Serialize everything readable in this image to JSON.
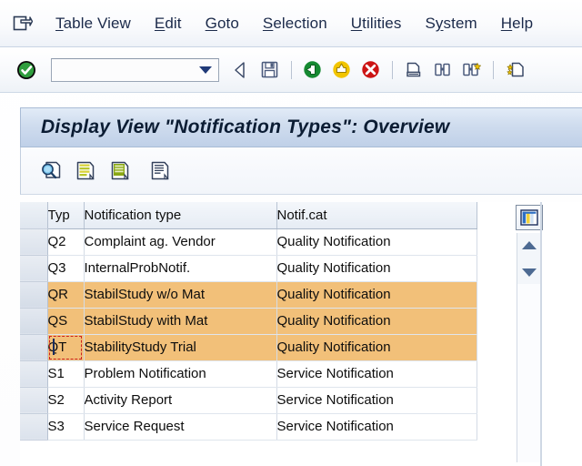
{
  "window": {
    "icon": "sap-exit-arrow-icon"
  },
  "menubar": {
    "items": [
      {
        "label": "Table View",
        "accel_index": 0
      },
      {
        "label": "Edit",
        "accel_index": 0
      },
      {
        "label": "Goto",
        "accel_index": 0
      },
      {
        "label": "Selection",
        "accel_index": 0
      },
      {
        "label": "Utilities",
        "accel_index": 0
      },
      {
        "label": "System",
        "accel_index": 1
      },
      {
        "label": "Help",
        "accel_index": 0
      }
    ]
  },
  "toolbar": {
    "enter_icon": "green-check-enter-icon",
    "command_field": {
      "value": "",
      "placeholder": ""
    },
    "dropdown_icon": "chevron-down-icon",
    "buttons": [
      {
        "name": "back-triangle-button",
        "icon": "left-triangle-icon",
        "title": "Back"
      },
      {
        "name": "save-button",
        "icon": "floppy-disk-icon",
        "title": "Save"
      },
      {
        "name": "green-back-button",
        "icon": "green-left-arrow-icon",
        "title": "Back"
      },
      {
        "name": "exit-button",
        "icon": "yellow-up-arrow-icon",
        "title": "Exit"
      },
      {
        "name": "cancel-button",
        "icon": "red-x-icon",
        "title": "Cancel"
      },
      {
        "name": "print-button",
        "icon": "printer-icon",
        "title": "Print"
      },
      {
        "name": "find-button",
        "icon": "binoculars-icon",
        "title": "Find"
      },
      {
        "name": "find-next-button",
        "icon": "binoculars-plus-icon",
        "title": "Find Next"
      },
      {
        "name": "first-page-button",
        "icon": "document-star-icon",
        "title": "First Page"
      }
    ]
  },
  "title": {
    "text": "Display View \"Notification Types\": Overview"
  },
  "app_toolbar": {
    "buttons": [
      {
        "name": "details-button",
        "icon": "magnifier-document-icon",
        "title": "Details"
      },
      {
        "name": "new-entries-button",
        "icon": "yellow-lines-document-icon",
        "title": "New Entries"
      },
      {
        "name": "copy-as-button",
        "icon": "green-lines-document-icon",
        "title": "Copy As"
      },
      {
        "name": "display-button",
        "icon": "lines-document-icon",
        "title": "Display"
      }
    ]
  },
  "table": {
    "columns": [
      {
        "key": "typ",
        "label": "Typ"
      },
      {
        "key": "name",
        "label": "Notification type"
      },
      {
        "key": "cat",
        "label": "Notif.cat"
      }
    ],
    "rows": [
      {
        "typ": "Q2",
        "name": "Complaint ag. Vendor",
        "cat": "Quality Notification",
        "highlighted": false,
        "focused": false
      },
      {
        "typ": "Q3",
        "name": "InternalProbNotif.",
        "cat": "Quality Notification",
        "highlighted": false,
        "focused": false
      },
      {
        "typ": "QR",
        "name": "StabilStudy w/o Mat",
        "cat": "Quality Notification",
        "highlighted": true,
        "focused": false
      },
      {
        "typ": "QS",
        "name": "StabilStudy with Mat",
        "cat": "Quality Notification",
        "highlighted": true,
        "focused": false
      },
      {
        "typ": "QT",
        "name": "StabilityStudy Trial",
        "cat": "Quality Notification",
        "highlighted": true,
        "focused": true
      },
      {
        "typ": "S1",
        "name": "Problem Notification",
        "cat": "Service Notification",
        "highlighted": false,
        "focused": false
      },
      {
        "typ": "S2",
        "name": "Activity Report",
        "cat": "Service Notification",
        "highlighted": false,
        "focused": false
      },
      {
        "typ": "S3",
        "name": "Service Request",
        "cat": "Service Notification",
        "highlighted": false,
        "focused": false
      }
    ]
  },
  "sidepanel": {
    "config_icon": "column-config-icon",
    "scroll_up_icon": "triangle-up-icon",
    "scroll_down_icon": "triangle-down-icon"
  },
  "colors": {
    "highlight_row": "#f2c079",
    "title_panel": "#cfdcee",
    "focus_border": "#cc2020",
    "menu_text": "#1b2a4a"
  }
}
